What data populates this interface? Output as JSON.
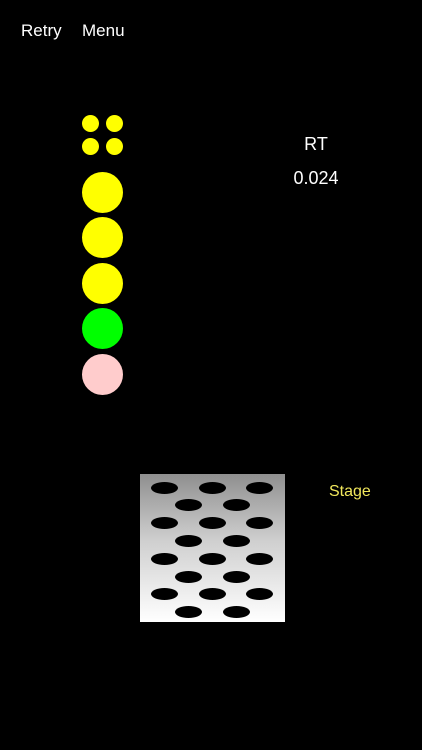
{
  "topbar": {
    "retry_label": "Retry",
    "menu_label": "Menu"
  },
  "lights": {
    "small": [
      "#ffff00",
      "#ffff00",
      "#ffff00",
      "#ffff00"
    ],
    "big": [
      "#ffff00",
      "#ffff00",
      "#ffff00",
      "#00ff00",
      "#ffcccc"
    ]
  },
  "reaction": {
    "label": "RT",
    "value": "0.024"
  },
  "stage": {
    "label": "Stage",
    "label_color": "#f2e85c"
  },
  "colors": {
    "background": "#000000",
    "text": "#ffffff"
  }
}
